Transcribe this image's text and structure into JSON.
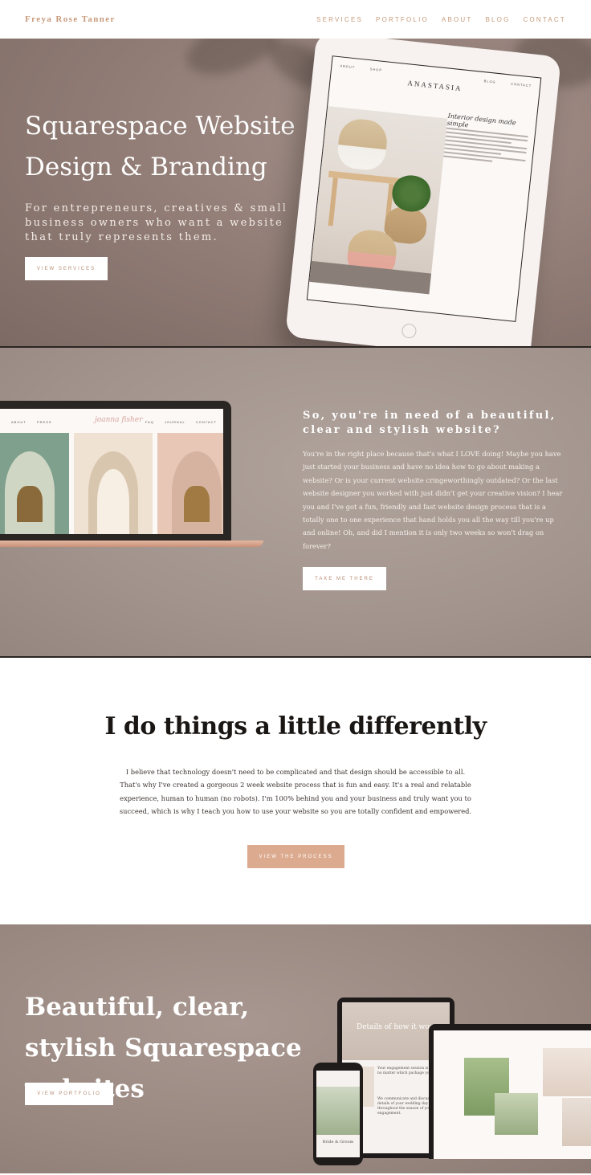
{
  "header": {
    "brand": "Freya Rose Tanner",
    "nav": [
      "SERVICES",
      "PORTFOLIO",
      "ABOUT",
      "BLOG",
      "CONTACT"
    ]
  },
  "hero": {
    "title": "Squarespace Website Design & Branding",
    "subtitle": "For entrepreneurs, creatives & small business owners who want a website that truly represents them.",
    "button": "VIEW SERVICES",
    "tablet": {
      "nav": [
        "ABOUT",
        "SHOP",
        "BLOG",
        "CONTACT"
      ],
      "logo": "ANASTASIA",
      "heading": "Interior design made simple"
    }
  },
  "need": {
    "title": "So, you're in need of a beautiful, clear and stylish website?",
    "body": "You're in the right place because that's what I LOVE doing! Maybe you have just started your business and have no idea how to go about making a website? Or is your current website cringeworthingly outdated? Or the last website designer you worked with just didn't get your creative vision? I hear you and I've got a fun, friendly and fast website design process that is a totally one to one experience that hand holds you all the way till you're up and online! Oh, and did I mention it is only two weeks so won't drag on forever?",
    "button": "TAKE ME THERE",
    "laptop": {
      "nav_left": [
        "ABOUT",
        "PRESS"
      ],
      "nav_right": [
        "FAQ",
        "JOURNAL",
        "CONTACT"
      ],
      "logo": "joanna fisher"
    }
  },
  "diff": {
    "title": "I do things a little differently",
    "body": "I believe that technology doesn't need to be complicated and that design should be accessible to all. That's why I've created a gorgeous 2 week website process that is fun and easy. It's a real and relatable experience, human to human (no robots). I'm 100% behind you and your business and truly want you to succeed, which is why I teach you how to use your website so you are totally confident and empowered.",
    "button": "VIEW THE PROCESS"
  },
  "portfolio": {
    "title": "Beautiful, clear, stylish Squarespace websites",
    "button": "VIEW PORTFOLIO",
    "tablet_heading": "Details of how it wor",
    "tablet_text": "Your engagement session is included no matter which package you book.",
    "tablet_text2": "We communicate and discuss the details of your wedding day throughout the season of your engagement.",
    "phone_caption": "Bride & Groom"
  },
  "colors": {
    "accent": "#c79a7b",
    "button_fill": "#dcab8f",
    "hero_bg": "#8f7b74",
    "need_bg": "#a2948d",
    "portfolio_bg": "#998880"
  }
}
